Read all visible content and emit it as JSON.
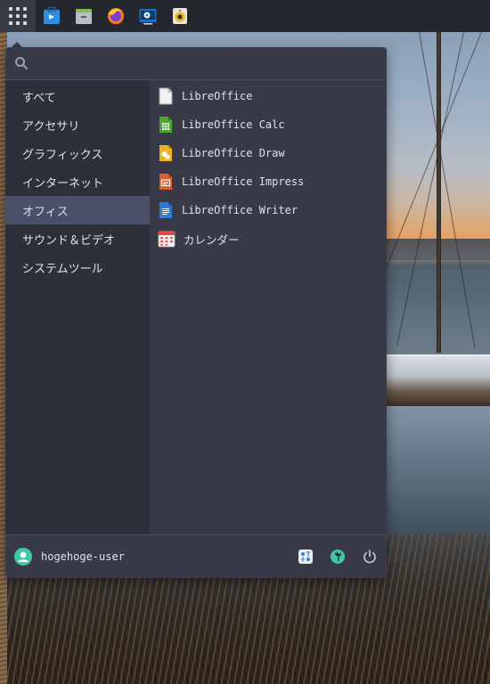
{
  "taskbar": {
    "launchers": [
      {
        "icon": "software-store-icon"
      },
      {
        "icon": "file-archive-icon"
      },
      {
        "icon": "firefox-icon"
      },
      {
        "icon": "media-player-icon"
      },
      {
        "icon": "speaker-icon"
      }
    ]
  },
  "search": {
    "value": "",
    "placeholder": ""
  },
  "categories": [
    {
      "label": "すべて",
      "active": false
    },
    {
      "label": "アクセサリ",
      "active": false
    },
    {
      "label": "グラフィックス",
      "active": false
    },
    {
      "label": "インターネット",
      "active": false
    },
    {
      "label": "オフィス",
      "active": true
    },
    {
      "label": "サウンド＆ビデオ",
      "active": false
    },
    {
      "label": "システムツール",
      "active": false
    }
  ],
  "apps": [
    {
      "label": "LibreOffice",
      "icon": "libreoffice-icon"
    },
    {
      "label": "LibreOffice Calc",
      "icon": "libreoffice-calc-icon"
    },
    {
      "label": "LibreOffice Draw",
      "icon": "libreoffice-draw-icon"
    },
    {
      "label": "LibreOffice Impress",
      "icon": "libreoffice-impress-icon"
    },
    {
      "label": "LibreOffice Writer",
      "icon": "libreoffice-writer-icon"
    },
    {
      "label": "カレンダー",
      "icon": "calendar-icon"
    }
  ],
  "footer": {
    "username": "hogehoge-user",
    "buttons": [
      "settings-panel-icon",
      "wrench-icon",
      "power-icon"
    ]
  },
  "colors": {
    "menu_bg": "#383b47",
    "sidebar_bg": "#2e3039",
    "active_category": "#4a5068",
    "avatar": "#3ec8a8"
  }
}
